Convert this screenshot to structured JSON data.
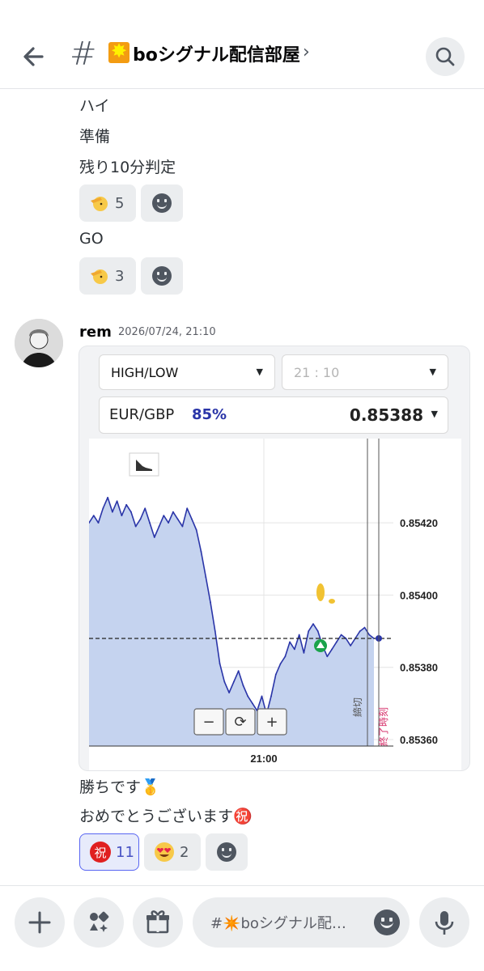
{
  "header": {
    "back_icon": "arrow-left-icon",
    "channel_prefix": "#",
    "channel_name": "boシグナル配信部屋",
    "chevron": "›",
    "search_icon": "search-icon"
  },
  "messages": [
    {
      "text": "ハイ"
    },
    {
      "text": "準備"
    },
    {
      "text": "残り10分判定"
    }
  ],
  "reactions_1": [
    {
      "emoji": "saluting-face-icon",
      "count": "5"
    }
  ],
  "go_message": "GO",
  "reactions_2": [
    {
      "emoji": "saluting-face-icon",
      "count": "3"
    }
  ],
  "post": {
    "author": "rem",
    "timestamp": "2026/07/24, 21:10",
    "text_1": "勝ちです🥇",
    "text_2": "おめでとうございます㊗️",
    "reactions": [
      {
        "emoji": "congratulations-icon",
        "label": "祝",
        "count": "11",
        "active": true
      },
      {
        "emoji": "heart-eyes-icon",
        "count": "2",
        "active": false
      }
    ]
  },
  "trade": {
    "type_select": "HIGH/LOW",
    "time_select": "21 : 10",
    "pair": "EUR/GBP",
    "payout": "85%",
    "price": "0.85388",
    "close_label": "締切",
    "end_label": "終了時刻",
    "time_axis": "21:00",
    "zoom_out": "−",
    "reset": "⟳",
    "zoom_in": "+",
    "accent_blue": "#2a35a8",
    "area_fill": "#c5d3ef"
  },
  "chart_data": {
    "type": "line",
    "title": "",
    "xlabel": "",
    "ylabel": "",
    "x_ticks": [
      "21:00"
    ],
    "y_ticks": [
      "0.85420",
      "0.85400",
      "0.85380",
      "0.85360"
    ],
    "ylim": [
      0.8536,
      0.8544
    ],
    "series": [
      {
        "values": [
          0.8542,
          0.85422,
          0.8542,
          0.85424,
          0.85427,
          0.85423,
          0.85426,
          0.85422,
          0.85425,
          0.85423,
          0.85419,
          0.85421,
          0.85424,
          0.8542,
          0.85416,
          0.85419,
          0.85422,
          0.8542,
          0.85423,
          0.85421,
          0.85419,
          0.85424,
          0.85421,
          0.85418,
          0.85412,
          0.85405,
          0.85398,
          0.8539,
          0.85381,
          0.85376,
          0.85373,
          0.85376,
          0.85379,
          0.85375,
          0.85372,
          0.8537,
          0.85368,
          0.85372,
          0.85367,
          0.85372,
          0.85378,
          0.85381,
          0.85383,
          0.85387,
          0.85385,
          0.85389,
          0.85384,
          0.8539,
          0.85392,
          0.8539,
          0.85386,
          0.85383,
          0.85385,
          0.85387,
          0.85389,
          0.85388,
          0.85386,
          0.85388,
          0.8539,
          0.85391,
          0.85389,
          0.85388
        ]
      }
    ],
    "reference_line": 0.85388,
    "grid": true
  },
  "bottom": {
    "plus_icon": "plus-icon",
    "apps_icon": "apps-icon",
    "gift_icon": "gift-icon",
    "input_placeholder": "#✴️boシグナル配…",
    "emoji_icon": "emoji-icon",
    "mic_icon": "microphone-icon"
  }
}
